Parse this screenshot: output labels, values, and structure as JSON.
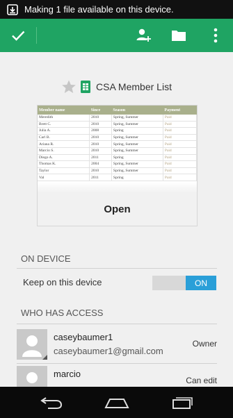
{
  "status": {
    "message": "Making 1 file available on this device."
  },
  "toolbar": {
    "done_icon": "check-icon",
    "add_person_icon": "add-person-icon",
    "folder_icon": "folder-icon",
    "overflow_icon": "overflow-menu-icon"
  },
  "file": {
    "name": "CSA Member List",
    "open_label": "Open"
  },
  "preview_table": {
    "headers": [
      "Member name",
      "Since",
      "Season",
      "Payment"
    ],
    "rows": [
      [
        "Meredith",
        "2010",
        "Spring, Summer",
        "Paid"
      ],
      [
        "Brett C.",
        "2010",
        "Spring, Summer",
        "Paid"
      ],
      [
        "Julia A.",
        "2008",
        "Spring",
        "Paid"
      ],
      [
        "Carl B.",
        "2010",
        "Spring, Summer",
        "Paid"
      ],
      [
        "Ariana R.",
        "2010",
        "Spring, Summer",
        "Paid"
      ],
      [
        "Marcio S.",
        "2010",
        "Spring, Summer",
        "Paid"
      ],
      [
        "Diego A.",
        "2011",
        "Spring",
        "Paid"
      ],
      [
        "Thomas K.",
        "2004",
        "Spring, Summer",
        "Paid"
      ],
      [
        "Taylor",
        "2010",
        "Spring, Summer",
        "Paid"
      ],
      [
        "Val",
        "2011",
        "Spring",
        "Paid"
      ]
    ]
  },
  "on_device": {
    "header": "ON DEVICE",
    "keep_label": "Keep on this device",
    "toggle_state": "ON"
  },
  "access": {
    "header": "WHO HAS ACCESS",
    "people": [
      {
        "name": "caseybaumer1",
        "email": "caseybaumer1@gmail.com",
        "role": "Owner"
      },
      {
        "name": "marcio",
        "email": "",
        "role": "Can edit"
      }
    ]
  },
  "colors": {
    "action_bar": "#1fa463",
    "toggle_on": "#2a9fd8",
    "status_bar": "#111111"
  }
}
